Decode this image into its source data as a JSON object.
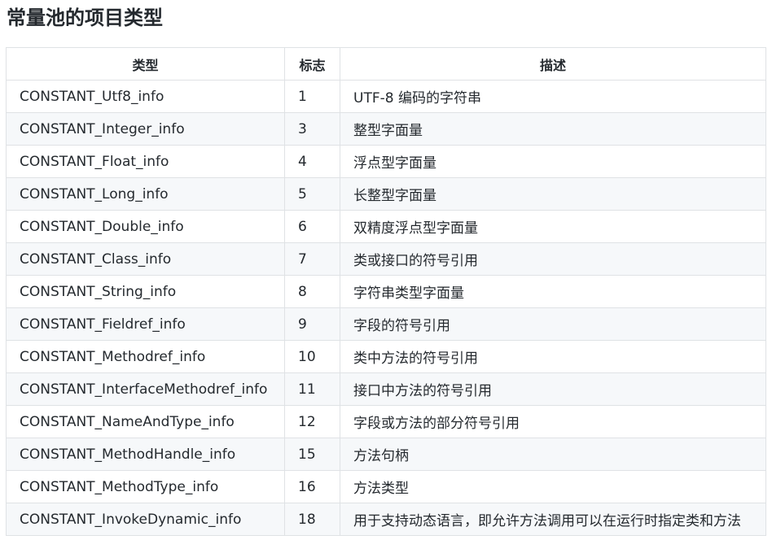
{
  "page": {
    "title": "常量池的项目类型"
  },
  "table": {
    "headers": {
      "type": "类型",
      "tag": "标志",
      "desc": "描述"
    },
    "rows": [
      {
        "type": "CONSTANT_Utf8_info",
        "tag": "1",
        "desc": "UTF-8 编码的字符串"
      },
      {
        "type": "CONSTANT_Integer_info",
        "tag": "3",
        "desc": "整型字面量"
      },
      {
        "type": "CONSTANT_Float_info",
        "tag": "4",
        "desc": "浮点型字面量"
      },
      {
        "type": "CONSTANT_Long_info",
        "tag": "5",
        "desc": "长整型字面量"
      },
      {
        "type": "CONSTANT_Double_info",
        "tag": "6",
        "desc": "双精度浮点型字面量"
      },
      {
        "type": "CONSTANT_Class_info",
        "tag": "7",
        "desc": "类或接口的符号引用"
      },
      {
        "type": "CONSTANT_String_info",
        "tag": "8",
        "desc": "字符串类型字面量"
      },
      {
        "type": "CONSTANT_Fieldref_info",
        "tag": "9",
        "desc": "字段的符号引用"
      },
      {
        "type": "CONSTANT_Methodref_info",
        "tag": "10",
        "desc": "类中方法的符号引用"
      },
      {
        "type": "CONSTANT_InterfaceMethodref_info",
        "tag": "11",
        "desc": "接口中方法的符号引用"
      },
      {
        "type": "CONSTANT_NameAndType_info",
        "tag": "12",
        "desc": "字段或方法的部分符号引用"
      },
      {
        "type": "CONSTANT_MethodHandle_info",
        "tag": "15",
        "desc": "方法句柄"
      },
      {
        "type": "CONSTANT_MethodType_info",
        "tag": "16",
        "desc": "方法类型"
      },
      {
        "type": "CONSTANT_InvokeDynamic_info",
        "tag": "18",
        "desc": "用于支持动态语言，即允许方法调用可以在运行时指定类和方法"
      }
    ]
  },
  "colors": {
    "text": "#24292e",
    "border": "#dfe2e5",
    "stripe": "#f6f8fa"
  }
}
